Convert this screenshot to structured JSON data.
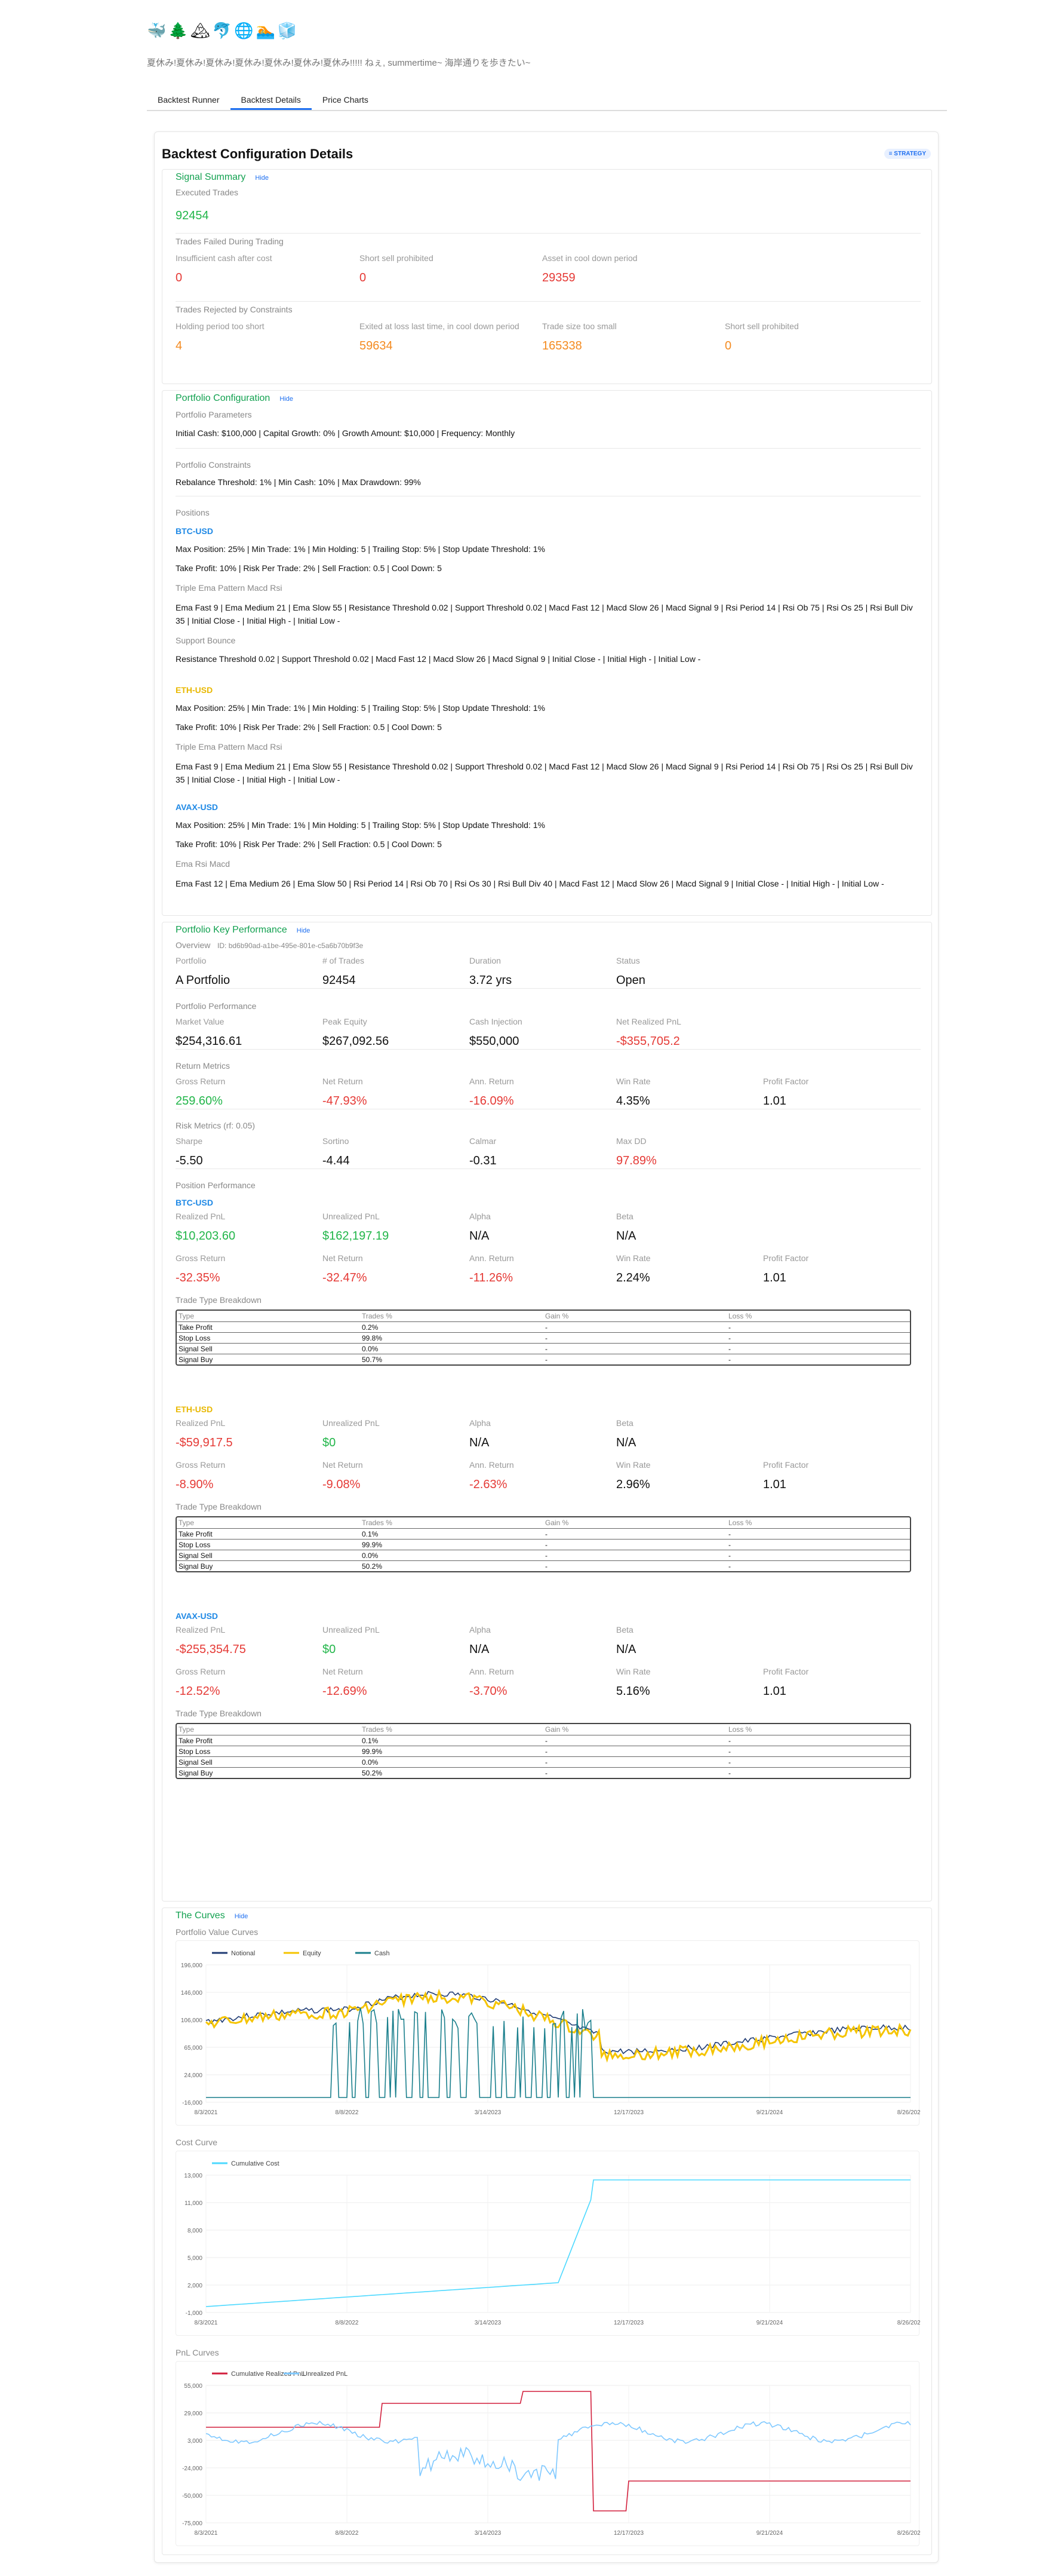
{
  "header": {
    "icons": [
      "🐳",
      "🌲",
      "🏔",
      "🐬",
      "🌐",
      "🏊",
      "🧊"
    ],
    "tagline": "夏休み!夏休み!夏休み!夏休み!夏休み!夏休み!夏休み!!!!! ねぇ, summertime~ 海岸通りを歩きたい~"
  },
  "tabs": [
    "Backtest Runner",
    "Backtest Details",
    "Price Charts"
  ],
  "page": {
    "title": "Backtest Configuration Details",
    "badge": "≡ STRATEGY"
  },
  "signal": {
    "title": "Signal Summary",
    "hide": "Hide",
    "executed_label": "Executed Trades",
    "executed_value": "92454",
    "failed_label": "Trades Failed During Trading",
    "failed": [
      {
        "label": "Insufficient cash after cost",
        "value": "0"
      },
      {
        "label": "Short sell prohibited",
        "value": "0"
      },
      {
        "label": "Asset in cool down period",
        "value": "29359"
      }
    ],
    "rejected_label": "Trades Rejected by Constraints",
    "rejected": [
      {
        "label": "Holding period too short",
        "value": "4"
      },
      {
        "label": "Exited at loss last time, in cool down period",
        "value": "59634"
      },
      {
        "label": "Trade size too small",
        "value": "165338"
      },
      {
        "label": "Short sell prohibited",
        "value": "0"
      }
    ]
  },
  "portfolio": {
    "title": "Portfolio Configuration",
    "hide": "Hide",
    "params_label": "Portfolio Parameters",
    "params": "Initial Cash: $100,000 | Capital Growth: 0% | Growth Amount: $10,000 | Frequency: Monthly",
    "constraints_label": "Portfolio Constraints",
    "constraints": "Rebalance Threshold: 1% | Min Cash: 10% | Max Drawdown: 99%",
    "positions_label": "Positions",
    "btc": {
      "name": "BTC-USD",
      "l1": "Max Position: 25% | Min Trade: 1% | Min Holding: 5 | Trailing Stop: 5% | Stop Update Threshold: 1%",
      "l2": "Take Profit: 10% | Risk Per Trade: 2% | Sell Fraction: 0.5 | Cool Down: 5",
      "s1": "Triple Ema Pattern Macd Rsi",
      "s1v": "Ema Fast 9 | Ema Medium 21 | Ema Slow 55 | Resistance Threshold 0.02 | Support Threshold 0.02 | Macd Fast 12 | Macd Slow 26 | Macd Signal 9 | Rsi Period 14 | Rsi Ob 75 | Rsi Os 25 | Rsi Bull Div 35 | Initial Close - | Initial High - | Initial Low -",
      "s2": "Support Bounce",
      "s2v": "Resistance Threshold 0.02 | Support Threshold 0.02 | Macd Fast 12 | Macd Slow 26 | Macd Signal 9 | Initial Close - | Initial High - | Initial Low -"
    },
    "eth": {
      "name": "ETH-USD",
      "l1": "Max Position: 25% | Min Trade: 1% | Min Holding: 5 | Trailing Stop: 5% | Stop Update Threshold: 1%",
      "l2": "Take Profit: 10% | Risk Per Trade: 2% | Sell Fraction: 0.5 | Cool Down: 5",
      "s1": "Triple Ema Pattern Macd Rsi",
      "s1v": "Ema Fast 9 | Ema Medium 21 | Ema Slow 55 | Resistance Threshold 0.02 | Support Threshold 0.02 | Macd Fast 12 | Macd Slow 26 | Macd Signal 9 | Rsi Period 14 | Rsi Ob 75 | Rsi Os 25 | Rsi Bull Div 35 | Initial Close - | Initial High - | Initial Low -"
    },
    "avax": {
      "name": "AVAX-USD",
      "l1": "Max Position: 25% | Min Trade: 1% | Min Holding: 5 | Trailing Stop: 5% | Stop Update Threshold: 1%",
      "l2": "Take Profit: 10% | Risk Per Trade: 2% | Sell Fraction: 0.5 | Cool Down: 5",
      "s1": "Ema Rsi Macd",
      "s1v": "Ema Fast 12 | Ema Medium 26 | Ema Slow 50 | Rsi Period 14 | Rsi Ob 70 | Rsi Os 30 | Rsi Bull Div 40 | Macd Fast 12 | Macd Slow 26 | Macd Signal 9 | Initial Close - | Initial High - | Initial Low -"
    }
  },
  "kpi": {
    "title": "Portfolio Key Performance",
    "hide": "Hide",
    "overview": "Overview",
    "id": "ID: bd6b90ad-a1be-495e-801e-c5a6b70b9f3e",
    "overview_items": [
      {
        "label": "Portfolio",
        "value": "A Portfolio"
      },
      {
        "label": "# of Trades",
        "value": "92454"
      },
      {
        "label": "Duration",
        "value": "3.72 yrs"
      },
      {
        "label": "Status",
        "value": "Open"
      }
    ],
    "perf_label": "Portfolio Performance",
    "perf": [
      {
        "label": "Market Value",
        "value": "$254,316.61",
        "c": "black"
      },
      {
        "label": "Peak Equity",
        "value": "$267,092.56",
        "c": "black"
      },
      {
        "label": "Cash Injection",
        "value": "$550,000",
        "c": "black"
      },
      {
        "label": "Net Realized PnL",
        "value": "-$355,705.2",
        "c": "red"
      }
    ],
    "ret_label": "Return Metrics",
    "ret": [
      {
        "label": "Gross Return",
        "value": "259.60%",
        "c": "green"
      },
      {
        "label": "Net Return",
        "value": "-47.93%",
        "c": "red"
      },
      {
        "label": "Ann. Return",
        "value": "-16.09%",
        "c": "red"
      },
      {
        "label": "Win Rate",
        "value": "4.35%",
        "c": "black"
      },
      {
        "label": "Profit Factor",
        "value": "1.01",
        "c": "black"
      }
    ],
    "risk_label": "Risk Metrics (rf: 0.05)",
    "risk": [
      {
        "label": "Sharpe",
        "value": "-5.50",
        "c": "black"
      },
      {
        "label": "Sortino",
        "value": "-4.44",
        "c": "black"
      },
      {
        "label": "Calmar",
        "value": "-0.31",
        "c": "black"
      },
      {
        "label": "Max DD",
        "value": "97.89%",
        "c": "red"
      }
    ],
    "pos_label": "Position Performance",
    "breakdown_label": "Trade Type Breakdown",
    "table_head": [
      "Type",
      "Trades %",
      "Gain %",
      "Loss %"
    ],
    "positions": [
      {
        "name": "BTC-USD",
        "color": "pos-blue",
        "r1": [
          {
            "label": "Realized PnL",
            "value": "$10,203.60",
            "c": "green"
          },
          {
            "label": "Unrealized PnL",
            "value": "$162,197.19",
            "c": "green"
          },
          {
            "label": "Alpha",
            "value": "N/A",
            "c": "black"
          },
          {
            "label": "Beta",
            "value": "N/A",
            "c": "black"
          }
        ],
        "r2": [
          {
            "label": "Gross Return",
            "value": "-32.35%",
            "c": "red"
          },
          {
            "label": "Net Return",
            "value": "-32.47%",
            "c": "red"
          },
          {
            "label": "Ann. Return",
            "value": "-11.26%",
            "c": "red"
          },
          {
            "label": "Win Rate",
            "value": "2.24%",
            "c": "black"
          },
          {
            "label": "Profit Factor",
            "value": "1.01",
            "c": "black"
          }
        ],
        "rows": [
          [
            "Take Profit",
            "0.2%",
            "-",
            "-"
          ],
          [
            "Stop Loss",
            "99.8%",
            "-",
            "-"
          ],
          [
            "Signal Sell",
            "0.0%",
            "-",
            "-"
          ],
          [
            "Signal Buy",
            "50.7%",
            "-",
            "-"
          ]
        ]
      },
      {
        "name": "ETH-USD",
        "color": "pos-yellow",
        "r1": [
          {
            "label": "Realized PnL",
            "value": "-$59,917.5",
            "c": "red"
          },
          {
            "label": "Unrealized PnL",
            "value": "$0",
            "c": "green"
          },
          {
            "label": "Alpha",
            "value": "N/A",
            "c": "black"
          },
          {
            "label": "Beta",
            "value": "N/A",
            "c": "black"
          }
        ],
        "r2": [
          {
            "label": "Gross Return",
            "value": "-8.90%",
            "c": "red"
          },
          {
            "label": "Net Return",
            "value": "-9.08%",
            "c": "red"
          },
          {
            "label": "Ann. Return",
            "value": "-2.63%",
            "c": "red"
          },
          {
            "label": "Win Rate",
            "value": "2.96%",
            "c": "black"
          },
          {
            "label": "Profit Factor",
            "value": "1.01",
            "c": "black"
          }
        ],
        "rows": [
          [
            "Take Profit",
            "0.1%",
            "-",
            "-"
          ],
          [
            "Stop Loss",
            "99.9%",
            "-",
            "-"
          ],
          [
            "Signal Sell",
            "0.0%",
            "-",
            "-"
          ],
          [
            "Signal Buy",
            "50.2%",
            "-",
            "-"
          ]
        ]
      },
      {
        "name": "AVAX-USD",
        "color": "pos-blue",
        "r1": [
          {
            "label": "Realized PnL",
            "value": "-$255,354.75",
            "c": "red"
          },
          {
            "label": "Unrealized PnL",
            "value": "$0",
            "c": "green"
          },
          {
            "label": "Alpha",
            "value": "N/A",
            "c": "black"
          },
          {
            "label": "Beta",
            "value": "N/A",
            "c": "black"
          }
        ],
        "r2": [
          {
            "label": "Gross Return",
            "value": "-12.52%",
            "c": "red"
          },
          {
            "label": "Net Return",
            "value": "-12.69%",
            "c": "red"
          },
          {
            "label": "Ann. Return",
            "value": "-3.70%",
            "c": "red"
          },
          {
            "label": "Win Rate",
            "value": "5.16%",
            "c": "black"
          },
          {
            "label": "Profit Factor",
            "value": "1.01",
            "c": "black"
          }
        ],
        "rows": [
          [
            "Take Profit",
            "0.1%",
            "-",
            "-"
          ],
          [
            "Stop Loss",
            "99.9%",
            "-",
            "-"
          ],
          [
            "Signal Sell",
            "0.0%",
            "-",
            "-"
          ],
          [
            "Signal Buy",
            "50.2%",
            "-",
            "-"
          ]
        ]
      }
    ]
  },
  "curves": {
    "title": "The Curves",
    "hide": "Hide",
    "pv_label": "Portfolio Value Curves",
    "cost_label": "Cost Curve",
    "pnl_label": "PnL Curves"
  },
  "chart_data": [
    {
      "type": "line",
      "title": "Portfolio Value Curves",
      "x_ticks": [
        "8/3/2021",
        "8/8/2022",
        "3/14/2023",
        "12/17/2023",
        "9/21/2024",
        "8/26/2025"
      ],
      "y_ticks": [
        "196,000",
        "146,000",
        "106,000",
        "65,000",
        "24,000",
        "-16,000"
      ],
      "series": [
        {
          "name": "Notional",
          "color": "#1f3b73"
        },
        {
          "name": "Equity",
          "color": "#f5c400"
        },
        {
          "name": "Cash",
          "color": "#1a7f8c"
        }
      ]
    },
    {
      "type": "line",
      "title": "Cost Curve",
      "x_ticks": [
        "8/3/2021",
        "8/8/2022",
        "3/14/2023",
        "12/17/2023",
        "9/21/2024",
        "8/26/2025"
      ],
      "y_ticks": [
        "13,000",
        "11,000",
        "8,000",
        "5,000",
        "2,000",
        "-1,000"
      ],
      "series": [
        {
          "name": "Cumulative Cost",
          "color": "#4dd9ff"
        }
      ]
    },
    {
      "type": "line",
      "title": "PnL Curves",
      "x_ticks": [
        "8/3/2021",
        "8/8/2022",
        "3/14/2023",
        "12/17/2023",
        "9/21/2024",
        "8/26/2025"
      ],
      "y_ticks": [
        "55,000",
        "29,000",
        "3,000",
        "-24,000",
        "-50,000",
        "-75,000"
      ],
      "series": [
        {
          "name": "Cumulative Realized PnL",
          "color": "#d21f3c"
        },
        {
          "name": "Unrealized PnL",
          "color": "#7ec8ff"
        }
      ]
    }
  ]
}
